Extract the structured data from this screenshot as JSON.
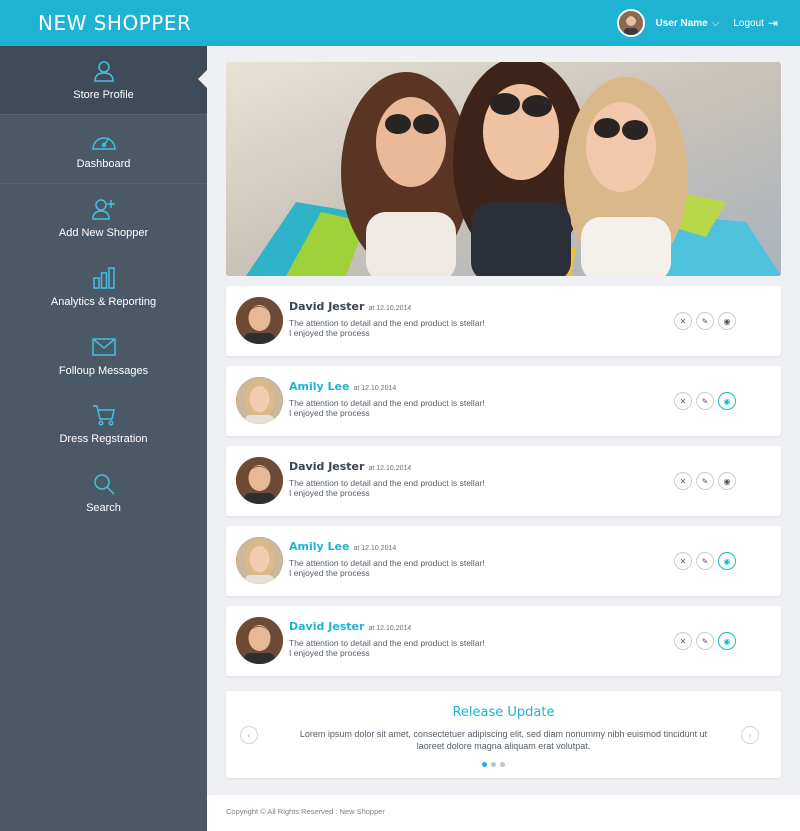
{
  "app": {
    "brand": "NEW SHOPPER"
  },
  "header": {
    "user_name": "User Name",
    "logout_label": "Logout"
  },
  "sidebar": {
    "items": [
      {
        "label": "Store Profile",
        "icon": "user-icon"
      },
      {
        "label": "Dashboard",
        "icon": "gauge-icon"
      },
      {
        "label": "Add New Shopper",
        "icon": "add-user-icon"
      },
      {
        "label": "Analytics & Reporting",
        "icon": "bar-chart-icon"
      },
      {
        "label": "Folloup Messages",
        "icon": "envelope-icon"
      },
      {
        "label": "Dress Regstration",
        "icon": "cart-icon"
      },
      {
        "label": "Search",
        "icon": "search-icon"
      }
    ]
  },
  "reviews": [
    {
      "name": "David Jester",
      "date": "at 12.10.2014",
      "line1": "The attention to detail and the end product is stellar!",
      "line2": "I enjoyed the process"
    },
    {
      "name": "Amily Lee",
      "date": "at 12.10.2014",
      "line1": "The attention to detail and the end product is stellar!",
      "line2": "I enjoyed the process"
    },
    {
      "name": "David Jester",
      "date": "at 12.10.2014",
      "line1": "The attention to detail and the end product is stellar!",
      "line2": "I enjoyed the process"
    },
    {
      "name": "Amily Lee",
      "date": "at 12.10.2014",
      "line1": "The attention to detail and the end product is stellar!",
      "line2": "I enjoyed the process"
    },
    {
      "name": "David Jester",
      "date": "at 12.10.2014",
      "line1": "The attention to detail and the end product is stellar!",
      "line2": "I enjoyed the process"
    }
  ],
  "release": {
    "title": "Release Update",
    "body": "Lorem ipsum dolor sit amet, consectetuer adipiscing elit, sed diam nonummy nibh euismod tincidunt ut laoreet dolore magna aliquam erat volutpat."
  },
  "footer": {
    "text": "Copyright © All Rights Reserved : New Shopper"
  },
  "colors": {
    "accent": "#1eb3d2",
    "sidebar": "#4b5966"
  }
}
